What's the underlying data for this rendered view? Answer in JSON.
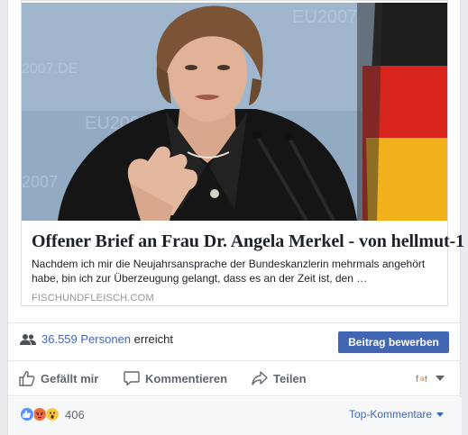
{
  "link": {
    "title": "Offener Brief an Frau Dr. Angela Merkel - von hellmut-1",
    "description": "Nachdem ich mir die Neujahrsansprache der Bundeskanzlerin mehrmals angehört habe, bin ich zur Überzeugung gelangt, dass es an der Zeit ist, den …",
    "domain": "FISCHUNDFLEISCH.COM"
  },
  "reach": {
    "count": "36.559",
    "people_label": "Personen",
    "reached_label": "erreicht",
    "boost_button": "Beitrag bewerben"
  },
  "actions": {
    "like": "Gefällt mir",
    "comment": "Kommentieren",
    "share": "Teilen"
  },
  "reactions": {
    "count": "406",
    "types": [
      "like",
      "angry",
      "wow"
    ],
    "sort_label": "Top-Kommentare"
  },
  "colors": {
    "brand_blue": "#4267b2",
    "like_blue": "#5890ff",
    "angry_orange": "#f06b3c",
    "wow_yellow": "#f7c744"
  }
}
